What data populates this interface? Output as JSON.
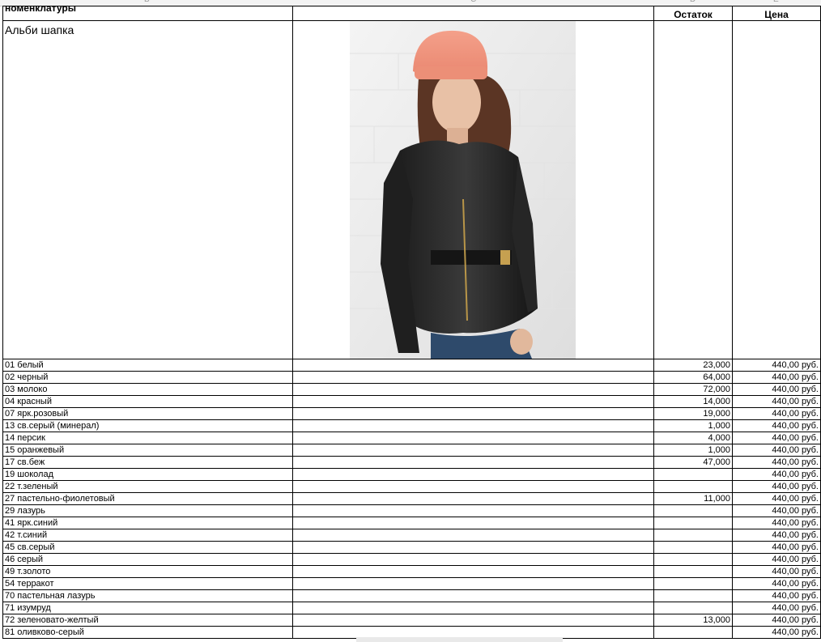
{
  "sheet": {
    "column_letters": [
      "B",
      "C",
      "D",
      "E"
    ],
    "headers": {
      "name": "номенклатуры",
      "stock": "Остаток",
      "price": "Цена"
    },
    "product": {
      "name": "Альби шапка"
    },
    "rows": [
      {
        "name": "01 белый",
        "stock": "23,000",
        "price": "440,00 руб."
      },
      {
        "name": "02 черный",
        "stock": "64,000",
        "price": "440,00 руб."
      },
      {
        "name": "03 молоко",
        "stock": "72,000",
        "price": "440,00 руб."
      },
      {
        "name": "04 красный",
        "stock": "14,000",
        "price": "440,00 руб."
      },
      {
        "name": "07 ярк.розовый",
        "stock": "19,000",
        "price": "440,00 руб."
      },
      {
        "name": "13 св.серый (минерал)",
        "stock": "1,000",
        "price": "440,00 руб."
      },
      {
        "name": "14 персик",
        "stock": "4,000",
        "price": "440,00 руб."
      },
      {
        "name": "15 оранжевый",
        "stock": "1,000",
        "price": "440,00 руб."
      },
      {
        "name": "17 св.беж",
        "stock": "47,000",
        "price": "440,00 руб."
      },
      {
        "name": "19 шоколад",
        "stock": "",
        "price": "440,00 руб."
      },
      {
        "name": "22 т.зеленый",
        "stock": "",
        "price": "440,00 руб."
      },
      {
        "name": "27 пастельно-фиолетовый",
        "stock": "11,000",
        "price": "440,00 руб."
      },
      {
        "name": "29 лазурь",
        "stock": "",
        "price": "440,00 руб."
      },
      {
        "name": "41 ярк.синий",
        "stock": "",
        "price": "440,00 руб."
      },
      {
        "name": "42 т.синий",
        "stock": "",
        "price": "440,00 руб."
      },
      {
        "name": "45 св.серый",
        "stock": "",
        "price": "440,00 руб."
      },
      {
        "name": "46 серый",
        "stock": "",
        "price": "440,00 руб."
      },
      {
        "name": "49 т.золото",
        "stock": "",
        "price": "440,00 руб."
      },
      {
        "name": "54 терракот",
        "stock": "",
        "price": "440,00 руб."
      },
      {
        "name": "70 пастельная лазурь",
        "stock": "",
        "price": "440,00 руб."
      },
      {
        "name": "71 изумруд",
        "stock": "",
        "price": "440,00 руб."
      },
      {
        "name": "72 зеленовато-желтый",
        "stock": "13,000",
        "price": "440,00 руб."
      },
      {
        "name": "81 оливково-серый",
        "stock": "",
        "price": "440,00 руб."
      }
    ]
  },
  "colors": {
    "grid": "#000000",
    "header_strip": "#f3f3f3"
  }
}
